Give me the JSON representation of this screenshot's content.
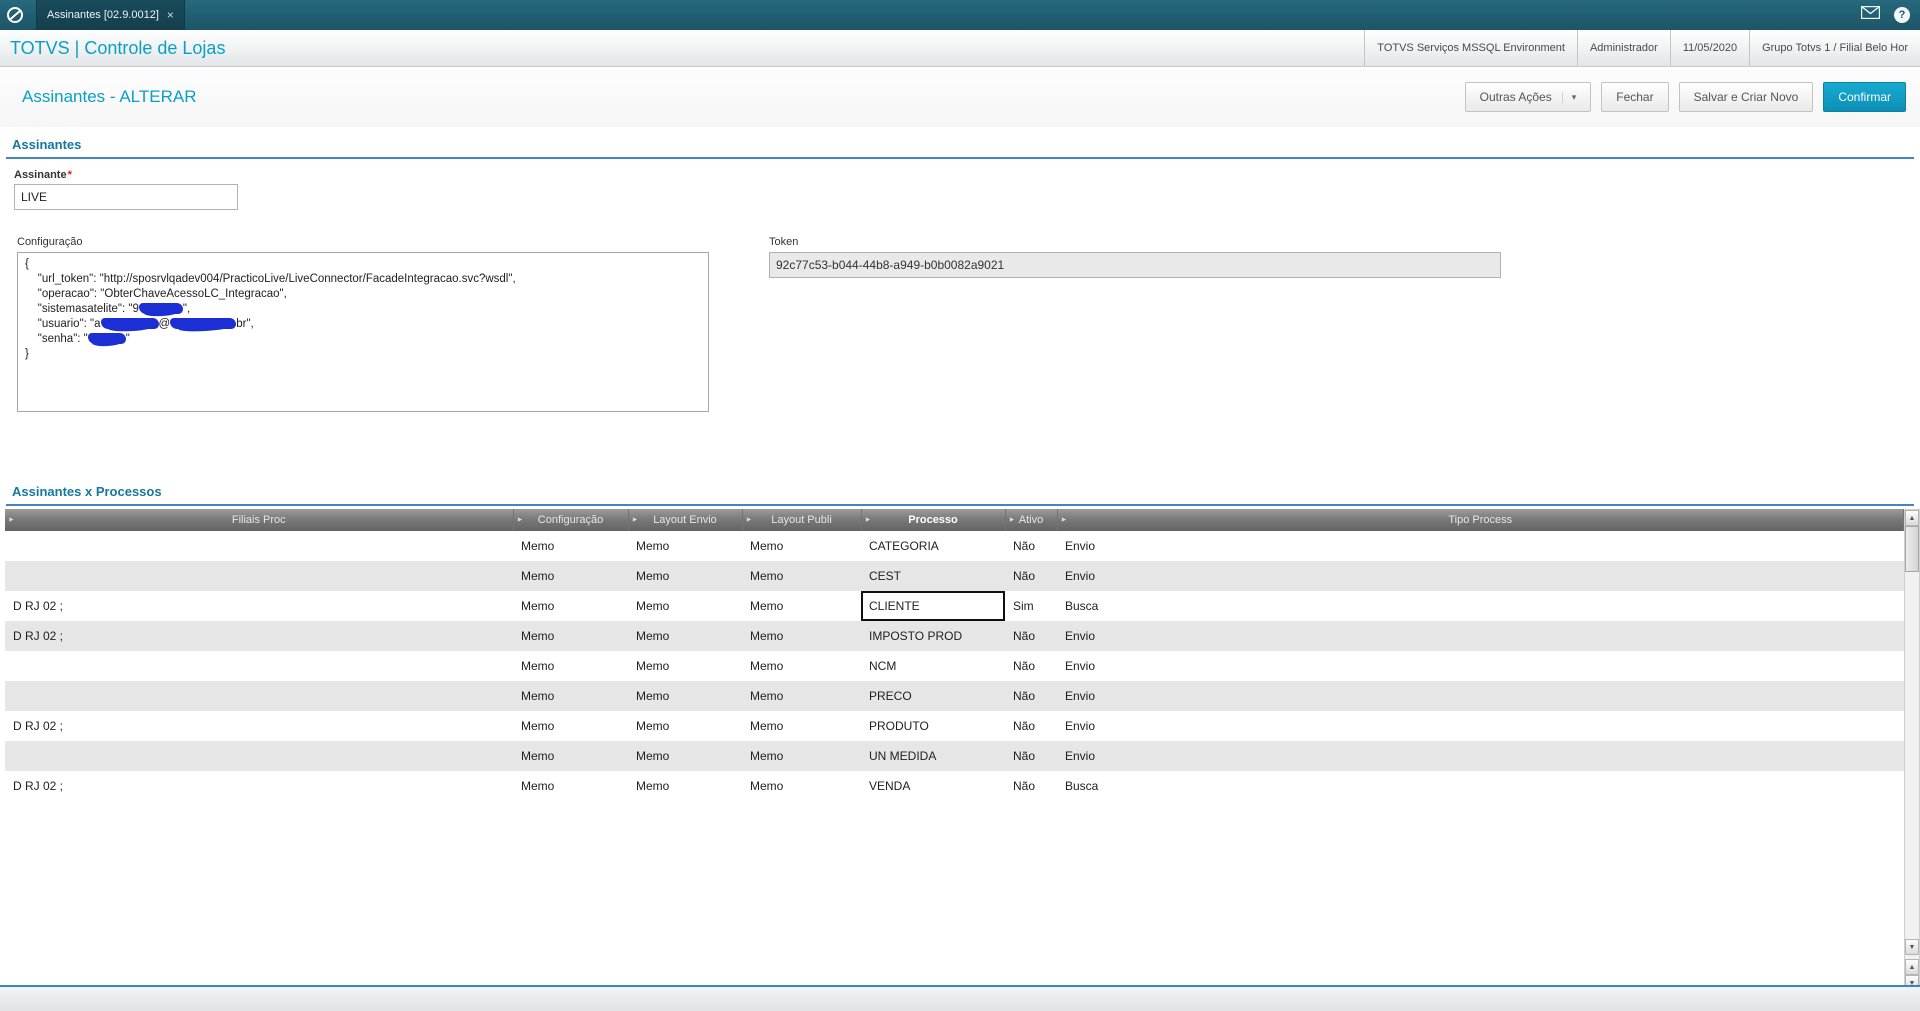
{
  "topbar": {
    "tab_label": "Assinantes [02.9.0012]",
    "tab_close": "×"
  },
  "header": {
    "title": "TOTVS | Controle de Lojas",
    "environment": "TOTVS Serviços MSSQL Environment",
    "user": "Administrador",
    "date": "11/05/2020",
    "company": "Grupo Totvs 1 / Filial Belo Hor"
  },
  "page": {
    "title": "Assinantes - ALTERAR",
    "buttons": {
      "outras_acoes": "Outras Ações",
      "outras_acoes_caret": "▾",
      "fechar": "Fechar",
      "salvar_criar": "Salvar e Criar Novo",
      "confirmar": "Confirmar"
    }
  },
  "form": {
    "section_title": "Assinantes",
    "assinante_label": "Assinante",
    "required_marker": "*",
    "assinante_value": "LIVE",
    "configuracao_label": "Configuração",
    "configuracao_lines": [
      [
        {
          "t": "{"
        }
      ],
      [
        {
          "t": "    \"url_token\": \"http://sposrvlqadev004/PracticoLive/LiveConnector/FacadeIntegracao.svc?wsdl\","
        }
      ],
      [
        {
          "t": "    \"operacao\": \"ObterChaveAcessoLC_Integracao\","
        }
      ],
      [
        {
          "t": "    \"sistemasatelite\": \"9"
        },
        {
          "r": 44
        },
        {
          "t": "\","
        }
      ],
      [
        {
          "t": "    \"usuario\": \"a"
        },
        {
          "r": 58
        },
        {
          "t": "@"
        },
        {
          "r": 66
        },
        {
          "t": "br\","
        }
      ],
      [
        {
          "t": "    \"senha\": \""
        },
        {
          "r": 38
        },
        {
          "t": "\""
        }
      ],
      [
        {
          "t": "}"
        }
      ]
    ],
    "token_label": "Token",
    "token_value": "92c77c53-b044-44b8-a949-b0b0082a9021"
  },
  "grid": {
    "section_title": "Assinantes x Processos",
    "column_arrow": "►",
    "columns": [
      {
        "key": "filiais",
        "label": "Filiais Proc"
      },
      {
        "key": "configuracao",
        "label": "Configuração"
      },
      {
        "key": "layout_envio",
        "label": "Layout Envio"
      },
      {
        "key": "layout_publi",
        "label": "Layout Publi"
      },
      {
        "key": "processo",
        "label": "Processo",
        "sorted": true
      },
      {
        "key": "ativo",
        "label": "Ativo"
      },
      {
        "key": "tipo",
        "label": "Tipo Process"
      }
    ],
    "rows": [
      {
        "filiais": "",
        "configuracao": "Memo",
        "layout_envio": "Memo",
        "layout_publi": "Memo",
        "processo": "CATEGORIA",
        "ativo": "Não",
        "tipo": "Envio"
      },
      {
        "filiais": "",
        "configuracao": "Memo",
        "layout_envio": "Memo",
        "layout_publi": "Memo",
        "processo": "CEST",
        "ativo": "Não",
        "tipo": "Envio"
      },
      {
        "filiais": "D RJ 02 ;",
        "configuracao": "Memo",
        "layout_envio": "Memo",
        "layout_publi": "Memo",
        "processo": "CLIENTE",
        "ativo": "Sim",
        "tipo": "Busca"
      },
      {
        "filiais": "D RJ 02 ;",
        "configuracao": "Memo",
        "layout_envio": "Memo",
        "layout_publi": "Memo",
        "processo": "IMPOSTO PROD",
        "ativo": "Não",
        "tipo": "Envio"
      },
      {
        "filiais": "",
        "configuracao": "Memo",
        "layout_envio": "Memo",
        "layout_publi": "Memo",
        "processo": "NCM",
        "ativo": "Não",
        "tipo": "Envio"
      },
      {
        "filiais": "",
        "configuracao": "Memo",
        "layout_envio": "Memo",
        "layout_publi": "Memo",
        "processo": "PRECO",
        "ativo": "Não",
        "tipo": "Envio"
      },
      {
        "filiais": "D RJ 02 ;",
        "configuracao": "Memo",
        "layout_envio": "Memo",
        "layout_publi": "Memo",
        "processo": "PRODUTO",
        "ativo": "Não",
        "tipo": "Envio"
      },
      {
        "filiais": "",
        "configuracao": "Memo",
        "layout_envio": "Memo",
        "layout_publi": "Memo",
        "processo": "UN MEDIDA",
        "ativo": "Não",
        "tipo": "Envio"
      },
      {
        "filiais": "D RJ 02 ;",
        "configuracao": "Memo",
        "layout_envio": "Memo",
        "layout_publi": "Memo",
        "processo": "VENDA",
        "ativo": "Não",
        "tipo": "Busca"
      }
    ],
    "selected": {
      "row": 2,
      "key": "processo"
    }
  },
  "scrollbar": {
    "up": "▲",
    "down": "▼"
  }
}
